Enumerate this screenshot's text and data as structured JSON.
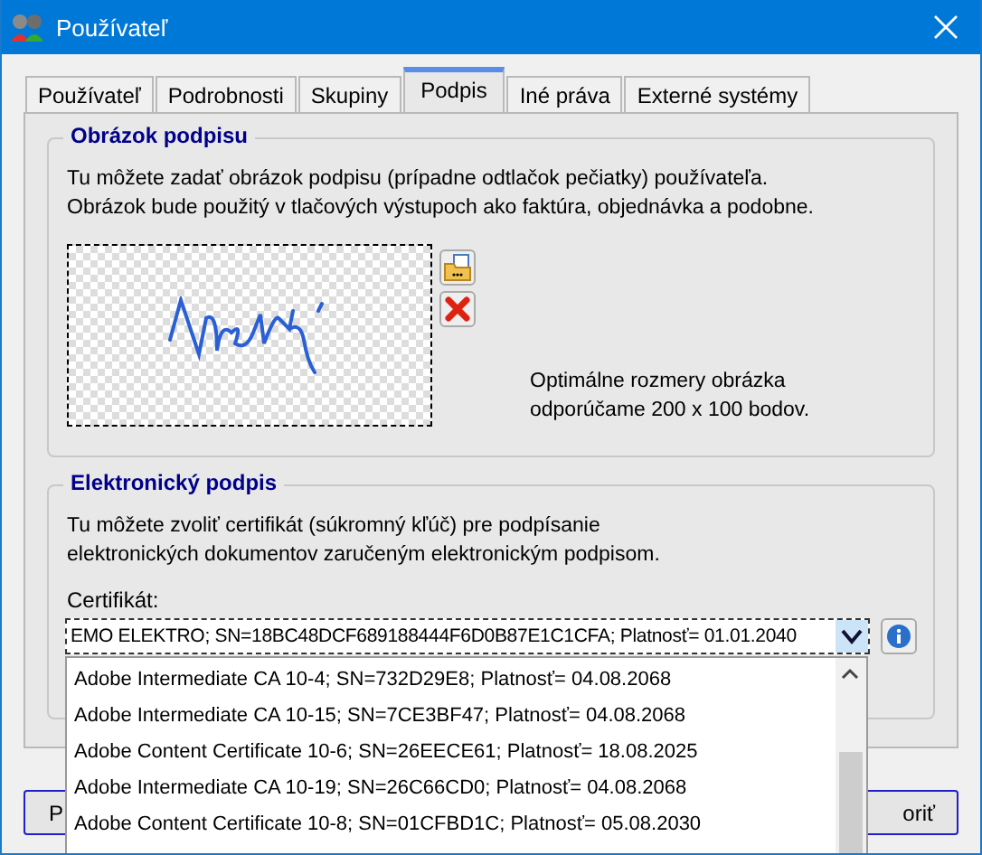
{
  "window": {
    "title": "Používateľ"
  },
  "tabs": [
    {
      "label": "Používateľ",
      "selected": false
    },
    {
      "label": "Podrobnosti",
      "selected": false
    },
    {
      "label": "Skupiny",
      "selected": false
    },
    {
      "label": "Podpis",
      "selected": true
    },
    {
      "label": "Iné práva",
      "selected": false
    },
    {
      "label": "Externé systémy",
      "selected": false
    }
  ],
  "signature_image": {
    "title": "Obrázok podpisu",
    "description": "Tu môžete zadať obrázok podpisu (prípadne odtlačok pečiatky) používateľa. Obrázok bude použitý v tlačových výstupoch ako faktúra, objednávka a podobne.",
    "hint": "Optimálne rozmery obrázka odporúčame 200 x 100 bodov."
  },
  "electronic_signature": {
    "title": "Elektronický podpis",
    "description": "Tu môžete zvoliť certifikát (súkromný kľúč) pre podpísanie elektronických dokumentov zaručeným elektronickým podpisom.",
    "certificate_label": "Certifikát:",
    "certificate_value": "EMO ELEKTRO; SN=18BC48DCF689188444F6D0B87E1C1CFA; Platnosť= 01.01.2040",
    "options": [
      {
        "label": "Adobe Intermediate CA 10-4; SN=732D29E8; Platnosť= 04.08.2068",
        "selected": false
      },
      {
        "label": "Adobe Intermediate CA 10-15; SN=7CE3BF47; Platnosť= 04.08.2068",
        "selected": false
      },
      {
        "label": "Adobe Content Certificate 10-6; SN=26EECE61; Platnosť= 18.08.2025",
        "selected": false
      },
      {
        "label": "Adobe Intermediate CA 10-19; SN=26C66CD0; Platnosť= 04.08.2068",
        "selected": false
      },
      {
        "label": "Adobe Content Certificate 10-8; SN=01CFBD1C; Platnosť= 05.08.2030",
        "selected": false
      }
    ]
  },
  "buttons": [
    "P",
    "oriť"
  ]
}
